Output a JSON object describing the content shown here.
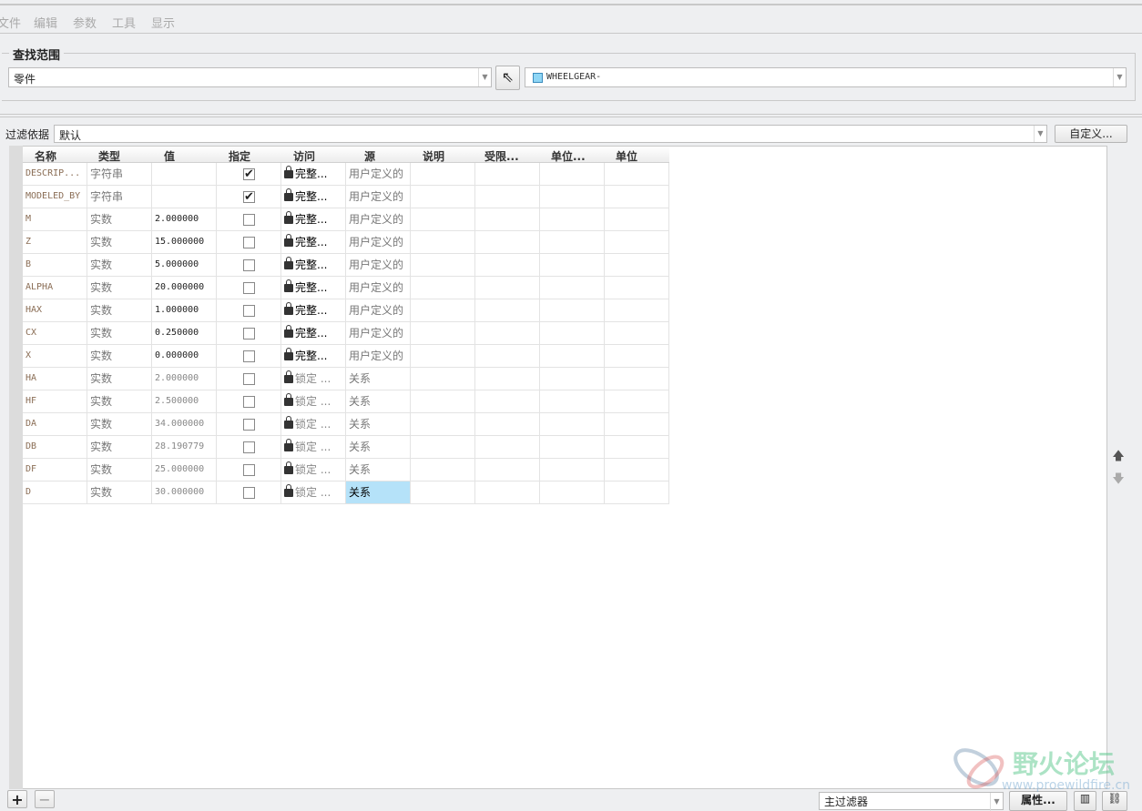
{
  "menu": [
    "文件",
    "编辑",
    "参数",
    "工具",
    "显示"
  ],
  "search_scope": {
    "title": "查找范围",
    "scope_value": "零件",
    "model_value": "WHEELGEAR-"
  },
  "filter": {
    "label": "过滤依据",
    "value": "默认",
    "customize_label": "自定义..."
  },
  "columns": [
    "名称",
    "类型",
    "值",
    "指定",
    "访问",
    "源",
    "说明",
    "受限...",
    "单位...",
    "单位"
  ],
  "rows": [
    {
      "name": "DESCRIP...",
      "type": "字符串",
      "value": "",
      "designate": true,
      "access": "完整...",
      "source": "用户定义的",
      "locked": false
    },
    {
      "name": "MODELED_BY",
      "type": "字符串",
      "value": "",
      "designate": true,
      "access": "完整...",
      "source": "用户定义的",
      "locked": false
    },
    {
      "name": "M",
      "type": "实数",
      "value": "2.000000",
      "designate": false,
      "access": "完整...",
      "source": "用户定义的",
      "locked": false
    },
    {
      "name": "Z",
      "type": "实数",
      "value": "15.000000",
      "designate": false,
      "access": "完整...",
      "source": "用户定义的",
      "locked": false
    },
    {
      "name": "B",
      "type": "实数",
      "value": "5.000000",
      "designate": false,
      "access": "完整...",
      "source": "用户定义的",
      "locked": false
    },
    {
      "name": "ALPHA",
      "type": "实数",
      "value": "20.000000",
      "designate": false,
      "access": "完整...",
      "source": "用户定义的",
      "locked": false
    },
    {
      "name": "HAX",
      "type": "实数",
      "value": "1.000000",
      "designate": false,
      "access": "完整...",
      "source": "用户定义的",
      "locked": false
    },
    {
      "name": "CX",
      "type": "实数",
      "value": "0.250000",
      "designate": false,
      "access": "完整...",
      "source": "用户定义的",
      "locked": false
    },
    {
      "name": "X",
      "type": "实数",
      "value": "0.000000",
      "designate": false,
      "access": "完整...",
      "source": "用户定义的",
      "locked": false
    },
    {
      "name": "HA",
      "type": "实数",
      "value": "2.000000",
      "designate": false,
      "access": "锁定 ...",
      "source": "关系",
      "locked": true
    },
    {
      "name": "HF",
      "type": "实数",
      "value": "2.500000",
      "designate": false,
      "access": "锁定 ...",
      "source": "关系",
      "locked": true
    },
    {
      "name": "DA",
      "type": "实数",
      "value": "34.000000",
      "designate": false,
      "access": "锁定 ...",
      "source": "关系",
      "locked": true
    },
    {
      "name": "DB",
      "type": "实数",
      "value": "28.190779",
      "designate": false,
      "access": "锁定 ...",
      "source": "关系",
      "locked": true
    },
    {
      "name": "DF",
      "type": "实数",
      "value": "25.000000",
      "designate": false,
      "access": "锁定 ...",
      "source": "关系",
      "locked": true
    },
    {
      "name": "D",
      "type": "实数",
      "value": "30.000000",
      "designate": false,
      "access": "锁定 ...",
      "source": "关系",
      "locked": true,
      "selected": true
    }
  ],
  "bottom": {
    "filter_value": "主过滤器",
    "properties_label": "属性..."
  },
  "watermark": {
    "title": "野火论坛",
    "url": "www.proewildfire.cn"
  },
  "colors": {
    "selected": "#b5e2f9"
  }
}
